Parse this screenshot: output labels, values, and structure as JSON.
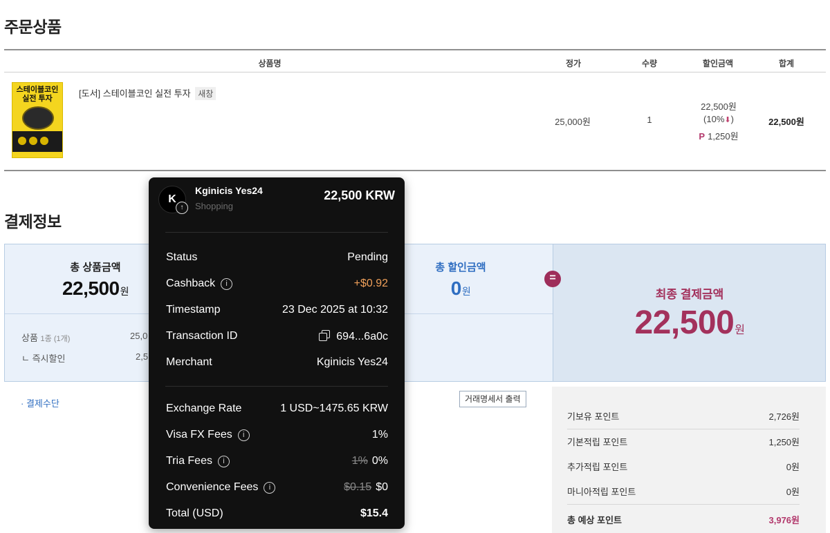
{
  "order": {
    "title": "주문상품",
    "columns": [
      "상품명",
      "정가",
      "수량",
      "할인금액",
      "합계"
    ],
    "item": {
      "cover_title": "스테이블코인 실전 투자",
      "name": "[도서] 스테이블코인 실전 투자",
      "new_window": "새창",
      "list_price": "25,000원",
      "qty": "1",
      "discount_price": "22,500원",
      "discount_pct": "(10%",
      "discount_close": ")",
      "point_badge": "P",
      "points": "1,250원",
      "total": "22,500원"
    }
  },
  "payment": {
    "title": "결제정보",
    "total_products_label": "총 상품금액",
    "total_products_amount": "22,500",
    "total_discount_label": "총 할인금액",
    "total_discount_amount": "0",
    "won": "원",
    "equals": "=",
    "final_label": "최종 결제금액",
    "final_amount": "22,500",
    "product_row_label": "상품",
    "product_row_count": "1종 (1개)",
    "product_row_value": "25,0",
    "instant_discount_label": "ㄴ 즉시할인",
    "instant_discount_value": "2,5",
    "method_label": "· 결제수단",
    "receipt_button": "거래명세서 출력"
  },
  "points": {
    "rows": [
      {
        "label": "기보유 포인트",
        "value": "2,726원"
      },
      {
        "label": "기본적립 포인트",
        "value": "1,250원"
      },
      {
        "label": "추가적립 포인트",
        "value": "0원"
      },
      {
        "label": "마니아적립 포인트",
        "value": "0원"
      }
    ],
    "total_label": "총 예상 포인트",
    "total_value": "3,976원"
  },
  "card": {
    "avatar_letter": "K",
    "merchant": "Kginicis Yes24",
    "category": "Shopping",
    "amount": "22,500 KRW",
    "status_label": "Status",
    "status_value": "Pending",
    "cashback_label": "Cashback",
    "cashback_value": "+$0.92",
    "timestamp_label": "Timestamp",
    "timestamp_value": "23 Dec 2025 at 10:32",
    "txid_label": "Transaction ID",
    "txid_value": "694...6a0c",
    "merchant_label": "Merchant",
    "merchant_value": "Kginicis Yes24",
    "fx_rate_label": "Exchange Rate",
    "fx_rate_value": "1 USD~1475.65 KRW",
    "visa_fee_label": "Visa FX Fees",
    "visa_fee_value": "1%",
    "tria_fee_label": "Tria Fees",
    "tria_fee_old": "1%",
    "tria_fee_value": "0%",
    "conv_fee_label": "Convenience Fees",
    "conv_fee_old": "$0.15",
    "conv_fee_value": "$0",
    "total_label": "Total (USD)",
    "total_value": "$15.4"
  },
  "colors": {
    "accent_maroon": "#a3315c",
    "accent_blue": "#2f6ec1",
    "cashback_orange": "#f0a05a",
    "card_bg": "#111111"
  }
}
